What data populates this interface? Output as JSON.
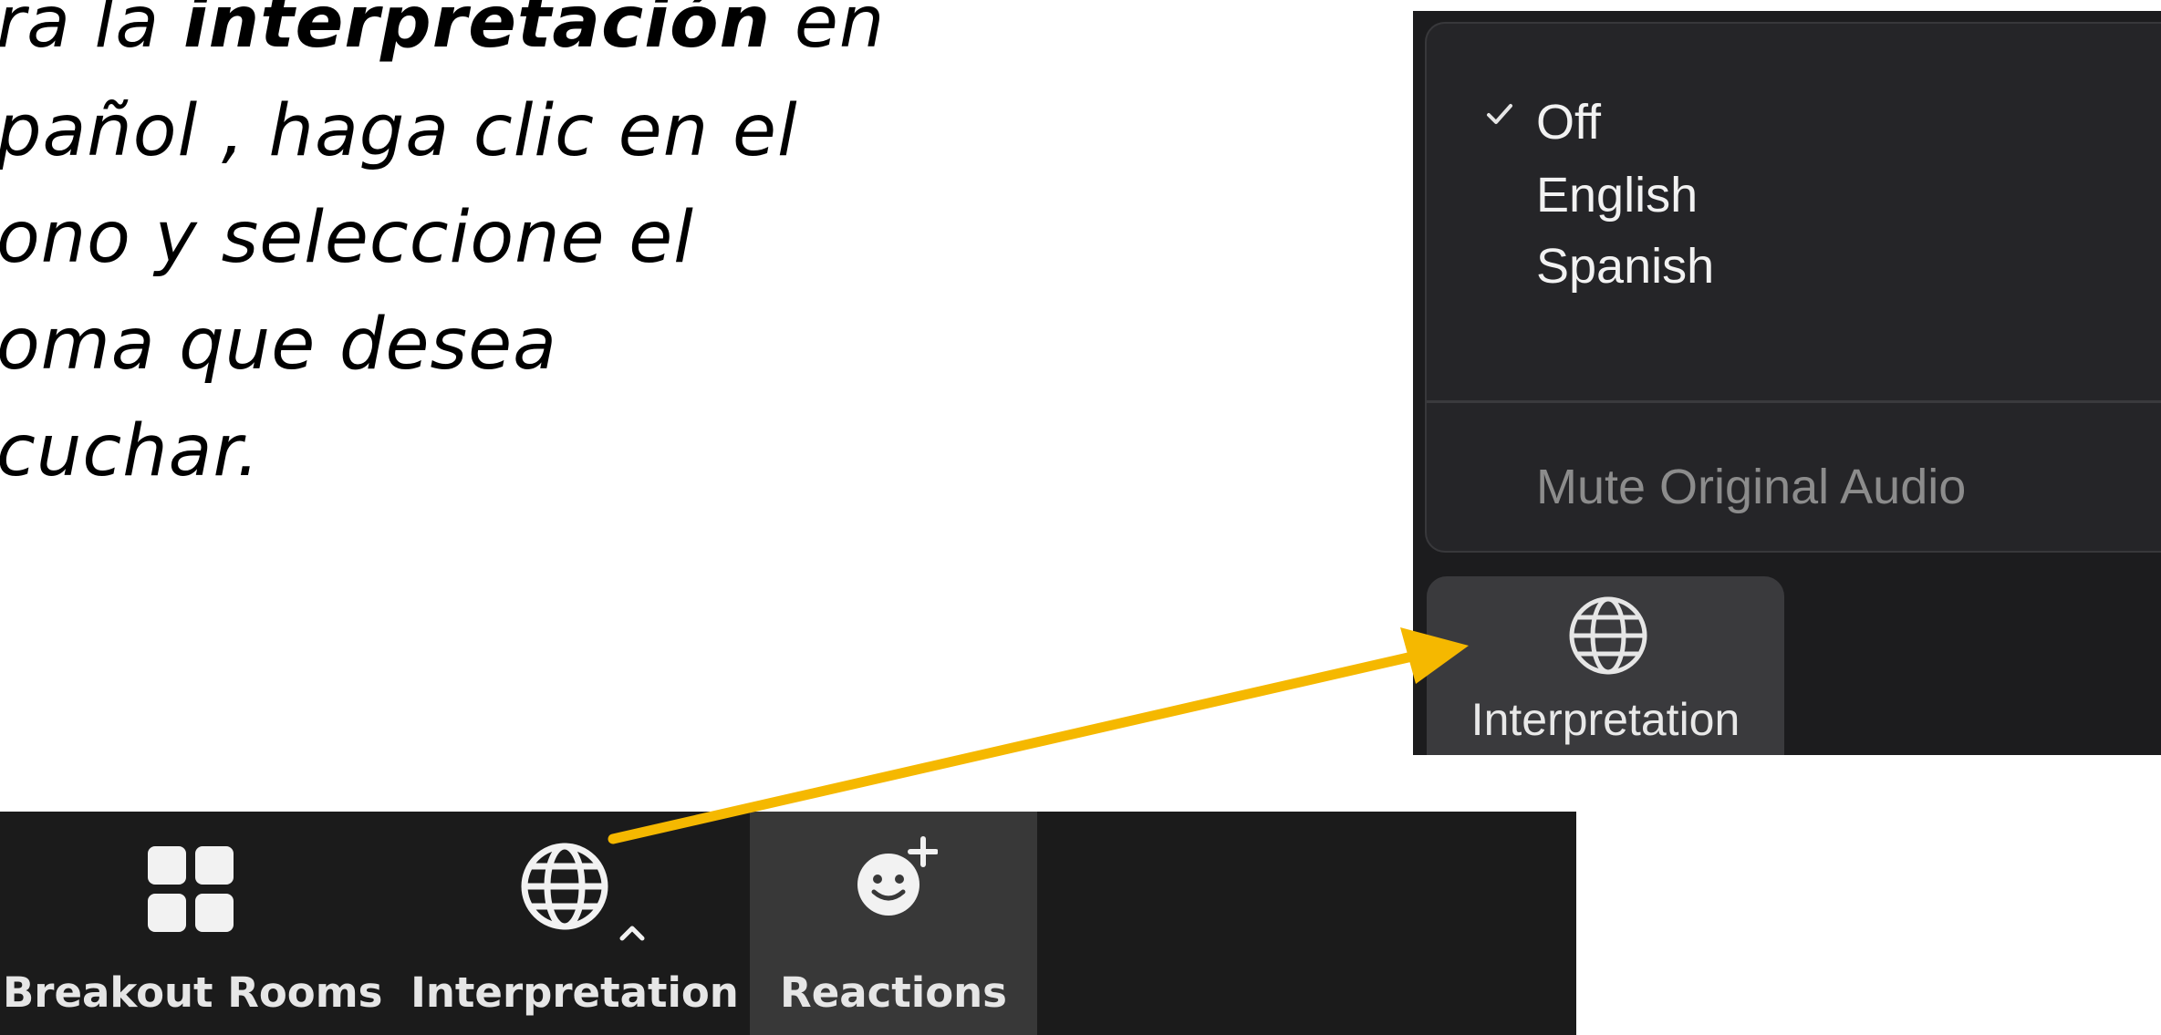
{
  "instruction": {
    "lines": [
      {
        "pre": "ra la ",
        "bold": "interpretación",
        "post": " en"
      },
      {
        "text": "pañol , haga clic en el"
      },
      {
        "text": "ono y seleccione el"
      },
      {
        "text": "oma que desea"
      },
      {
        "text": "cuchar."
      }
    ]
  },
  "interpretation_menu": {
    "items": [
      {
        "label": "Off",
        "checked": true
      },
      {
        "label": "English",
        "checked": false
      },
      {
        "label": "Spanish",
        "checked": false
      }
    ],
    "mute_original_audio": "Mute Original Audio",
    "button_label": "Interpretation",
    "button_icon": "globe-icon"
  },
  "toolbar": {
    "items": [
      {
        "label": "Breakout Rooms",
        "icon": "grid-icon"
      },
      {
        "label": "Interpretation",
        "icon": "globe-icon"
      },
      {
        "label": "Reactions",
        "icon": "add-reaction-icon"
      }
    ]
  },
  "colors": {
    "arrow": "#f5b800",
    "toolbar_bg": "#1b1b1b",
    "menu_bg": "#252528"
  }
}
